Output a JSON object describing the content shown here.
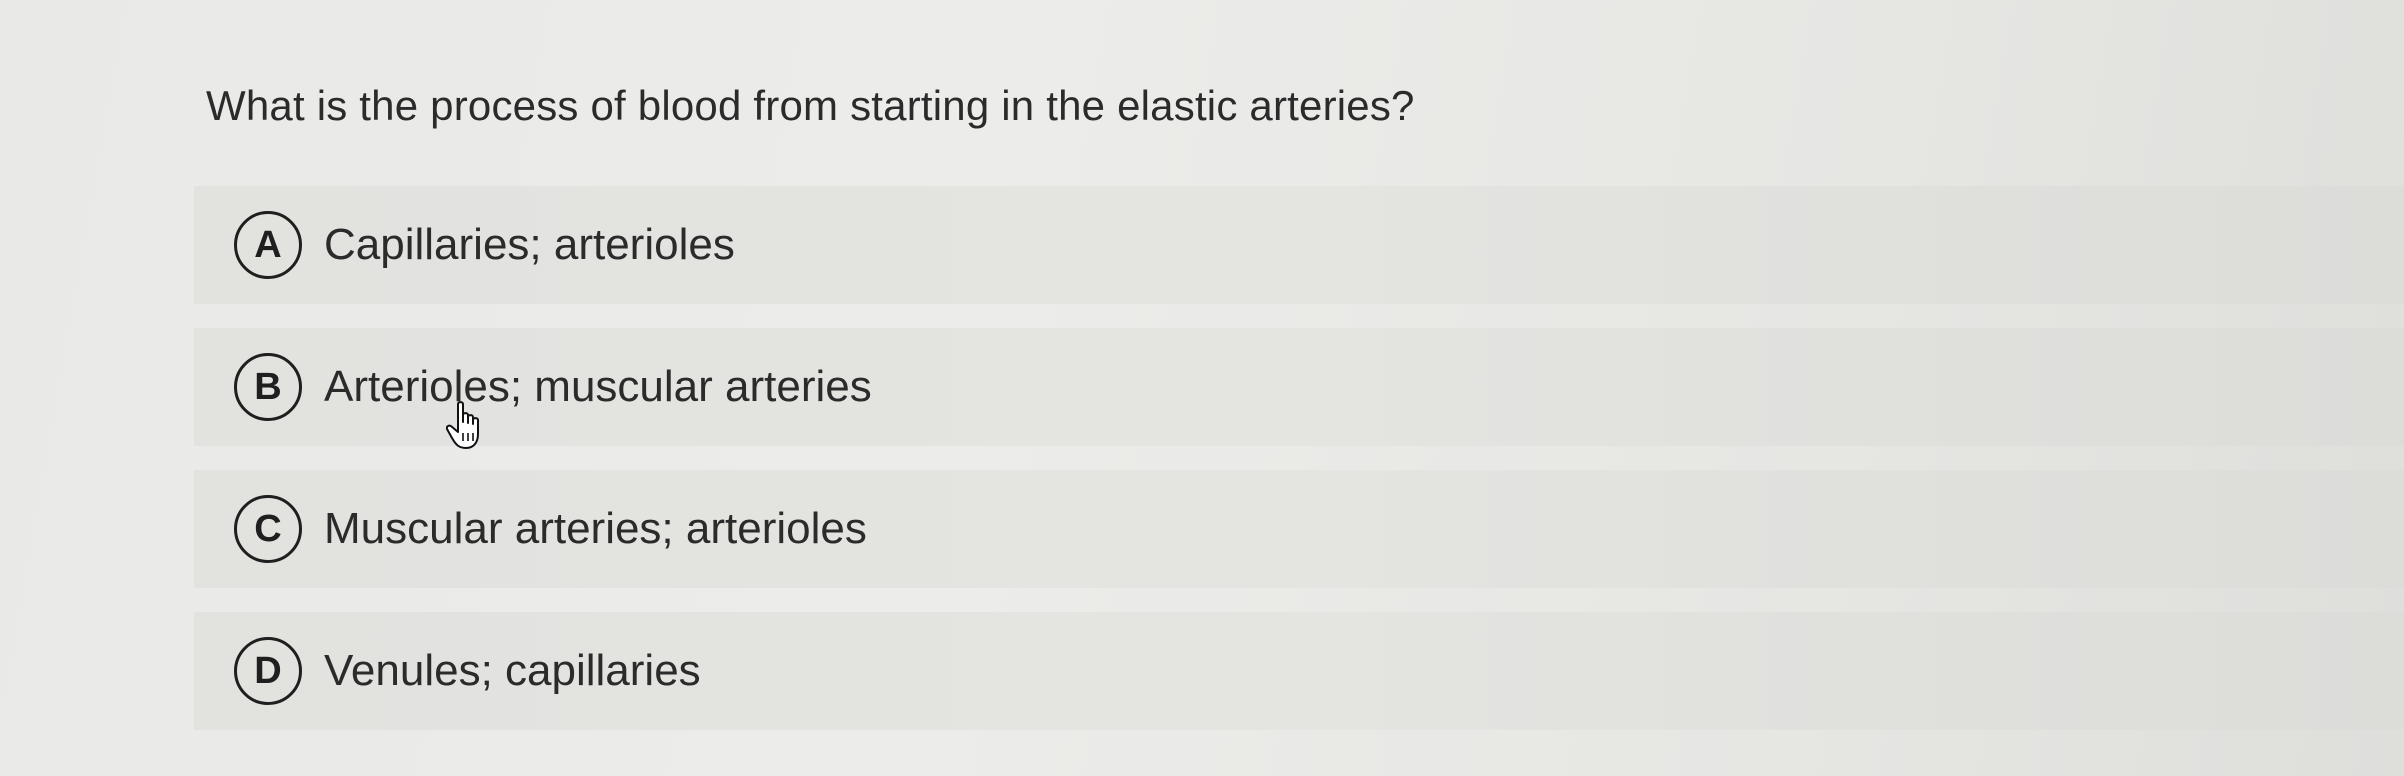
{
  "question": {
    "text": "What is the process of blood from starting in the elastic arteries?"
  },
  "options": [
    {
      "letter": "A",
      "label": "Capillaries; arterioles"
    },
    {
      "letter": "B",
      "label": "Arterioles; muscular arteries"
    },
    {
      "letter": "C",
      "label": "Muscular arteries; arterioles"
    },
    {
      "letter": "D",
      "label": "Venules; capillaries"
    }
  ],
  "icons": {
    "cursor": "hand-pointer-icon"
  }
}
